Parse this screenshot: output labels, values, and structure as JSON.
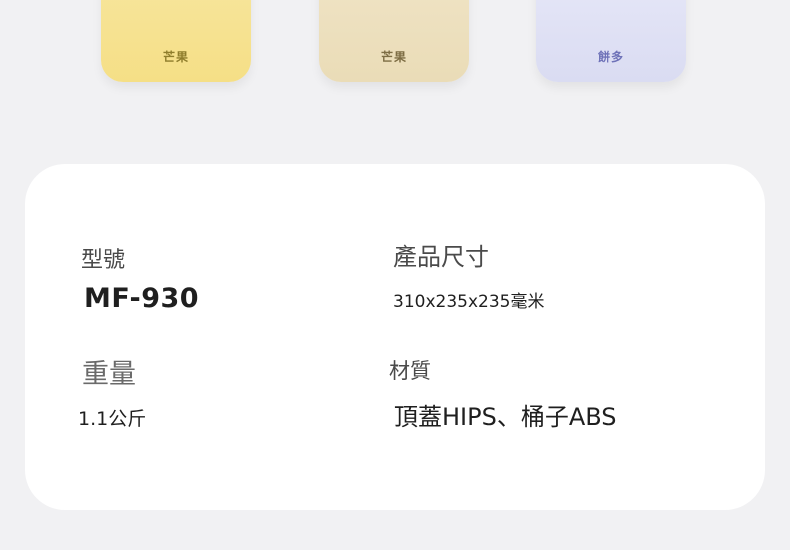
{
  "bins": [
    {
      "label": "芒果",
      "color": "#f6e18c"
    },
    {
      "label": "芒果",
      "color": "#ece0bd"
    },
    {
      "label": "餅多",
      "color": "#dfe0f5"
    }
  ],
  "specs": {
    "model": {
      "label": "型號",
      "value": "MF-930"
    },
    "size": {
      "label": "產品尺寸",
      "value": "310x235x235毫米"
    },
    "weight": {
      "label": "重量",
      "value": "1.1公斤"
    },
    "material": {
      "label": "材質",
      "value": "頂蓋HIPS、桶子ABS"
    }
  }
}
